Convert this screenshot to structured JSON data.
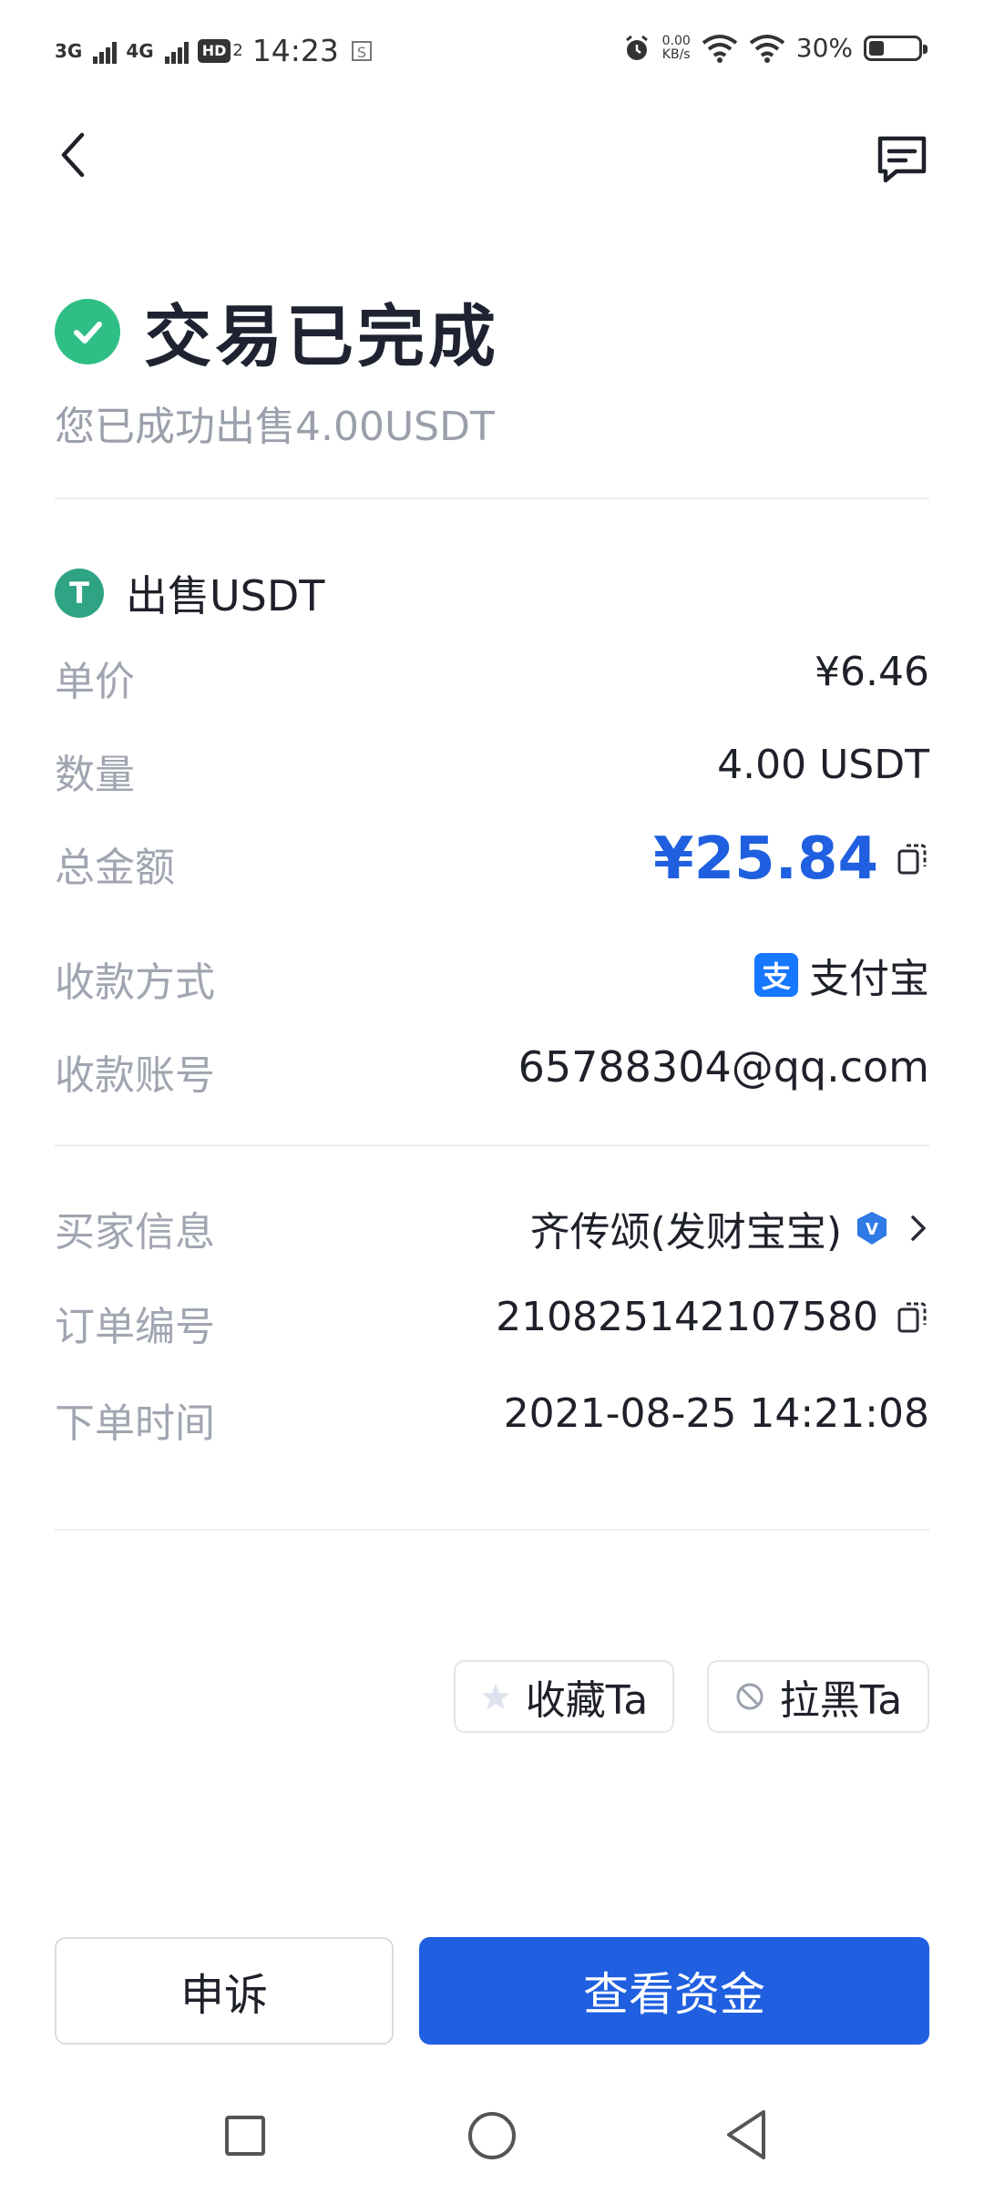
{
  "status_bar": {
    "net1": "3G",
    "net2": "4G",
    "hd": "HD",
    "hd_sub": "2",
    "time": "14:23",
    "speed_value": "0.00",
    "speed_unit": "KB/s",
    "battery": "30%"
  },
  "header": {
    "back_icon": "chevron-left-icon",
    "chat_icon": "chat-icon"
  },
  "status": {
    "title": "交易已完成",
    "subtitle": "您已成功出售4.00USDT"
  },
  "order": {
    "asset_icon_glyph": "T",
    "asset_label": "出售USDT",
    "rows": [
      {
        "label": "单价",
        "value": "¥6.46"
      },
      {
        "label": "数量",
        "value": "4.00 USDT"
      },
      {
        "label": "总金额",
        "value": "¥25.84"
      },
      {
        "label": "收款方式",
        "value": "支付宝"
      },
      {
        "label": "收款账号",
        "value": "65788304@qq.com"
      }
    ],
    "alipay_glyph": "支",
    "amount_color": "#1f5fe0"
  },
  "details": {
    "rows": [
      {
        "label": "买家信息",
        "value": "齐传颂(发财宝宝)"
      },
      {
        "label": "订单编号",
        "value": "210825142107580"
      },
      {
        "label": "下单时间",
        "value": "2021-08-25 14:21:08"
      }
    ],
    "verified_glyph": "V"
  },
  "actions": {
    "favorite": "收藏Ta",
    "block": "拉黑Ta",
    "appeal": "申诉",
    "view_funds": "查看资金"
  },
  "colors": {
    "primary": "#1f5fe0",
    "success": "#2fbf86",
    "tether": "#2ea484",
    "alipay": "#1677ff"
  }
}
